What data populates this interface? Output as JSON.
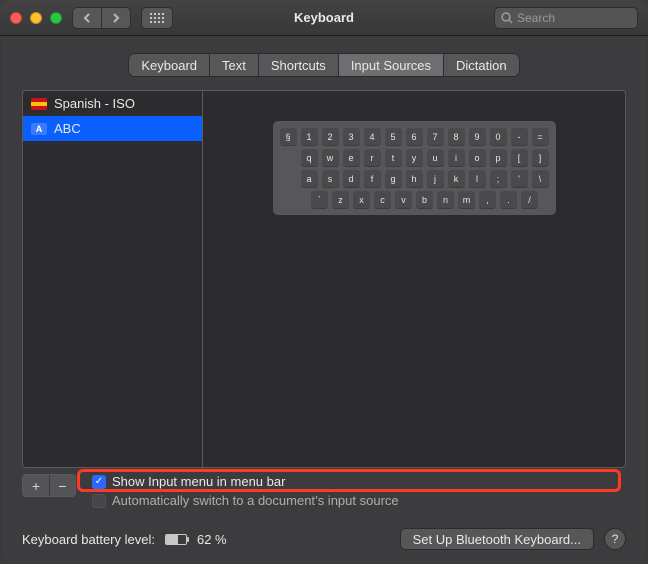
{
  "window": {
    "title": "Keyboard"
  },
  "search": {
    "placeholder": "Search"
  },
  "tabs": {
    "items": [
      {
        "label": "Keyboard"
      },
      {
        "label": "Text"
      },
      {
        "label": "Shortcuts"
      },
      {
        "label": "Input Sources",
        "active": true
      },
      {
        "label": "Dictation"
      }
    ]
  },
  "sources": [
    {
      "label": "Spanish - ISO",
      "type": "flag-es",
      "selected": false
    },
    {
      "label": "ABC",
      "type": "abc",
      "selected": true
    }
  ],
  "keyboard_preview": {
    "rows": [
      [
        "§",
        "1",
        "2",
        "3",
        "4",
        "5",
        "6",
        "7",
        "8",
        "9",
        "0",
        "-",
        "="
      ],
      [
        "q",
        "w",
        "e",
        "r",
        "t",
        "y",
        "u",
        "i",
        "o",
        "p",
        "[",
        "]"
      ],
      [
        "a",
        "s",
        "d",
        "f",
        "g",
        "h",
        "j",
        "k",
        "l",
        ";",
        "'",
        "\\"
      ],
      [
        "`",
        "z",
        "x",
        "c",
        "v",
        "b",
        "n",
        "m",
        ",",
        ".",
        "/"
      ]
    ]
  },
  "buttons": {
    "add": "+",
    "remove": "−",
    "setup_bt": "Set Up Bluetooth Keyboard..."
  },
  "checks": {
    "show_input_menu": {
      "label": "Show Input menu in menu bar",
      "checked": true
    },
    "auto_switch": {
      "label": "Automatically switch to a document’s input source",
      "checked": false
    }
  },
  "footer": {
    "battery_label": "Keyboard battery level:",
    "battery_pct": "62 %"
  },
  "colors": {
    "accent": "#0a60ff",
    "highlight": "#ff3a24"
  }
}
